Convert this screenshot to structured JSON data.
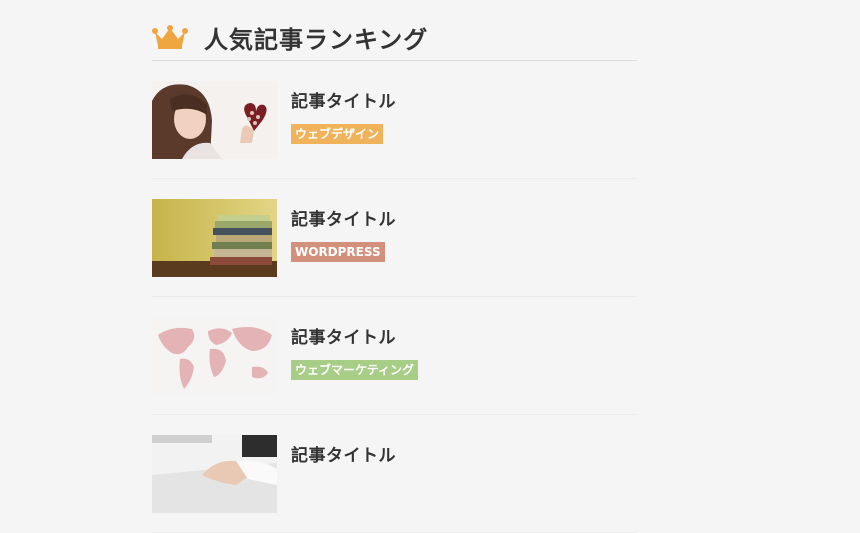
{
  "ranking": {
    "title": "人気記事ランキング",
    "icon": "crown-icon",
    "items": [
      {
        "title": "記事タイトル",
        "category": "ウェブデザイン",
        "color": "#f0b25a"
      },
      {
        "title": "記事タイトル",
        "category": "WORDPRESS",
        "color": "#d3907d"
      },
      {
        "title": "記事タイトル",
        "category": "ウェブマーケティング",
        "color": "#a7cd87"
      },
      {
        "title": "記事タイトル",
        "category": "",
        "color": "#f0b25a"
      }
    ]
  }
}
